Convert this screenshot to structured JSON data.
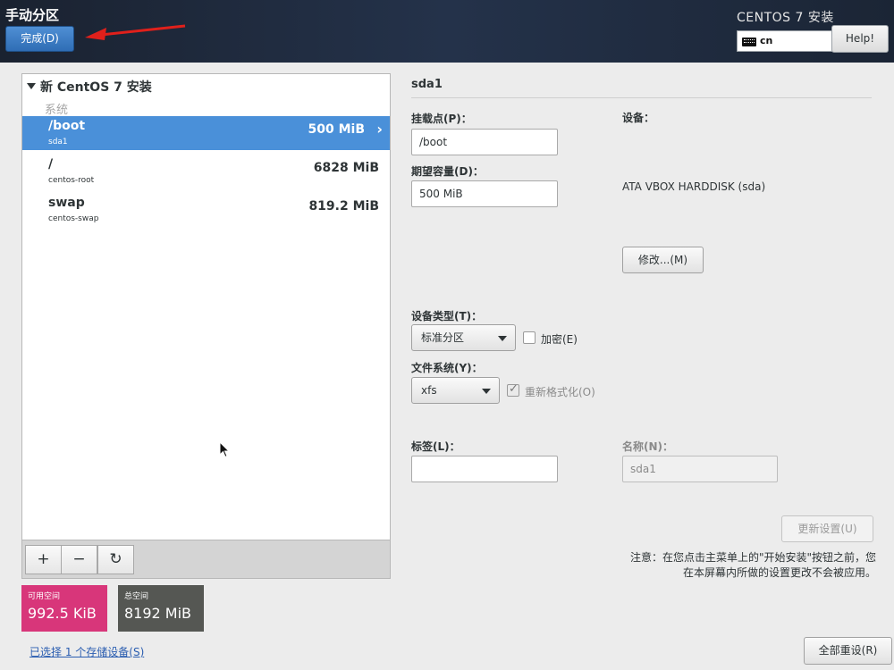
{
  "header": {
    "page_title": "手动分区",
    "done_label": "完成(D)",
    "product_title": "CENTOS 7 安装",
    "keyboard_layout": "cn",
    "help_label": "Help!"
  },
  "partitions": {
    "group_title": "新 CentOS 7 安装",
    "section_label": "系统",
    "items": [
      {
        "mount": "/boot",
        "device": "sda1",
        "size": "500 MiB",
        "selected": true
      },
      {
        "mount": "/",
        "device": "centos-root",
        "size": "6828 MiB",
        "selected": false
      },
      {
        "mount": "swap",
        "device": "centos-swap",
        "size": "819.2 MiB",
        "selected": false
      }
    ],
    "toolbar": {
      "add": "+",
      "remove": "−",
      "refresh": "↻"
    }
  },
  "space": {
    "available_label": "可用空间",
    "available_value": "992.5 KiB",
    "total_label": "总空间",
    "total_value": "8192 MiB",
    "available_color": "#d8367a",
    "total_color": "#555753"
  },
  "storage_link": "已选择 1 个存储设备(S)",
  "details": {
    "device_title": "sda1",
    "mount_point_label": "挂载点(P)：",
    "mount_point_value": "/boot",
    "capacity_label": "期望容量(D)：",
    "capacity_value": "500 MiB",
    "devices_label": "设备：",
    "devices_value": "ATA VBOX HARDDISK (sda)",
    "modify_label": "修改...(M)",
    "device_type_label": "设备类型(T)：",
    "device_type_value": "标准分区",
    "encrypt_label": "加密(E)",
    "fs_label": "文件系统(Y)：",
    "fs_value": "xfs",
    "reformat_label": "重新格式化(O)",
    "tag_label": "标签(L)：",
    "tag_value": "",
    "name_label": "名称(N)：",
    "name_value": "sda1",
    "update_label": "更新设置(U)",
    "note_line1": "注意：在您点击主菜单上的\"开始安装\"按钮之前，您",
    "note_line2": "在本屏幕内所做的设置更改不会被应用。",
    "reset_label": "全部重设(R)"
  },
  "accent_color": "#4a90d9"
}
